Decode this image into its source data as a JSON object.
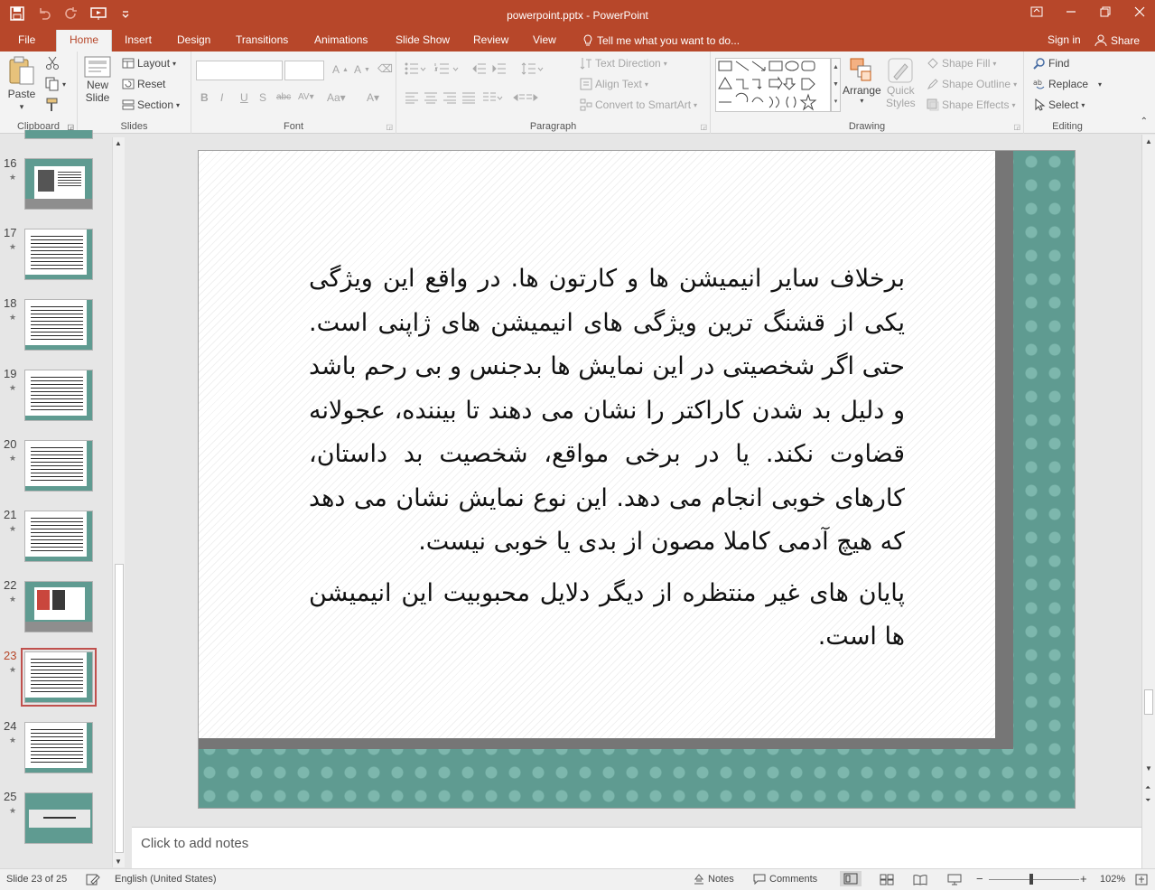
{
  "window": {
    "title": "powerpoint.pptx - PowerPoint"
  },
  "tabs": [
    {
      "label": "File"
    },
    {
      "label": "Home"
    },
    {
      "label": "Insert"
    },
    {
      "label": "Design"
    },
    {
      "label": "Transitions"
    },
    {
      "label": "Animations"
    },
    {
      "label": "Slide Show"
    },
    {
      "label": "Review"
    },
    {
      "label": "View"
    }
  ],
  "tellme": "Tell me what you want to do...",
  "account": {
    "signin": "Sign in",
    "share": "Share"
  },
  "ribbon": {
    "clipboard": {
      "label": "Clipboard",
      "paste": "Paste"
    },
    "slides": {
      "label": "Slides",
      "new_slide_1": "New",
      "new_slide_2": "Slide",
      "layout": "Layout",
      "reset": "Reset",
      "section": "Section"
    },
    "font": {
      "label": "Font"
    },
    "paragraph": {
      "label": "Paragraph",
      "text_direction": "Text Direction",
      "align_text": "Align Text",
      "convert_smartart": "Convert to SmartArt"
    },
    "drawing": {
      "label": "Drawing",
      "arrange": "Arrange",
      "quick_styles_1": "Quick",
      "quick_styles_2": "Styles",
      "shape_fill": "Shape Fill",
      "shape_outline": "Shape Outline",
      "shape_effects": "Shape Effects"
    },
    "editing": {
      "label": "Editing",
      "find": "Find",
      "replace": "Replace",
      "select": "Select"
    }
  },
  "thumbnails": [
    {
      "num": "16",
      "kind": "image"
    },
    {
      "num": "17",
      "kind": "text"
    },
    {
      "num": "18",
      "kind": "text"
    },
    {
      "num": "19",
      "kind": "text"
    },
    {
      "num": "20",
      "kind": "text"
    },
    {
      "num": "21",
      "kind": "text"
    },
    {
      "num": "22",
      "kind": "image"
    },
    {
      "num": "23",
      "kind": "text",
      "selected": true
    },
    {
      "num": "24",
      "kind": "text"
    },
    {
      "num": "25",
      "kind": "title"
    }
  ],
  "slide": {
    "paragraphs": [
      "برخلاف سایر انیمیشن ها و کارتون ها. در واقع این ویژگی یکی از قشنگ ترین ویژگی های انیمیشن های ژاپنی است. حتی اگر شخصیتی در این نمایش ها بدجنس و بی رحم باشد و دلیل بد شدن کاراکتر را نشان می دهند تا بیننده، عجولانه قضاوت نکند. یا در برخی مواقع، شخصیت بد داستان، کارهای خوبی انجام می دهد. این نوع نمایش نشان می دهد که هیچ آدمی کاملا مصون از بدی یا خوبی نیست.",
      "پایان های غیر منتظره از دیگر دلایل محبوبیت این انیمیشن ها است."
    ]
  },
  "notes": {
    "placeholder": "Click to add notes"
  },
  "status": {
    "slide_info": "Slide 23 of 25",
    "language": "English (United States)",
    "notes": "Notes",
    "comments": "Comments",
    "zoom": "102%"
  },
  "colors": {
    "accent": "#b7472a",
    "slide_teal": "#5f9b91"
  }
}
